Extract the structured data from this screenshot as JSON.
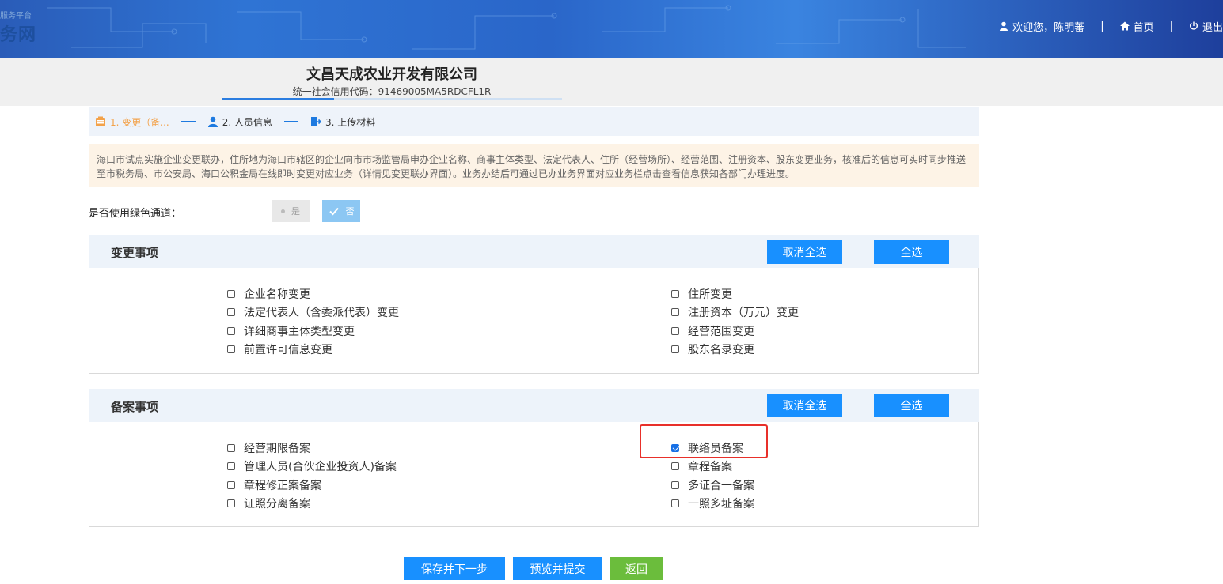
{
  "header": {
    "logo_small": "服务平台",
    "logo_text": "务网",
    "welcome": "欢迎您，陈明蕃",
    "home": "首页",
    "logout": "退出",
    "separator": "|"
  },
  "company": {
    "name": "文昌天成农业开发有限公司",
    "credit_code": "统一社会信用代码：91469005MA5RDCFL1R",
    "progress_fraction": 0.33
  },
  "steps": [
    {
      "label": "1. 变更（备...",
      "icon": "form-icon",
      "active": true
    },
    {
      "label": "2. 人员信息",
      "icon": "person-icon",
      "active": false
    },
    {
      "label": "3. 上传材料",
      "icon": "upload-icon",
      "active": false
    }
  ],
  "notice": "海口市试点实施企业变更联办，住所地为海口市辖区的企业向市市场监管局申办企业名称、商事主体类型、法定代表人、住所（经营场所）、经营范围、注册资本、股东变更业务，核准后的信息可实时同步推送至市税务局、市公安局、海口公积金局在线即时变更对应业务（详情见变更联办界面）。业务办结后可通过已办业务界面对应业务栏点击查看信息获知各部门办理进度。",
  "green_channel": {
    "label": "是否使用绿色通道：",
    "yes": "是",
    "no": "否",
    "selected": "否"
  },
  "change_section": {
    "title": "变更事项",
    "cancel_all": "取消全选",
    "select_all": "全选",
    "left": [
      {
        "label": "企业名称变更",
        "checked": false
      },
      {
        "label": "法定代表人（含委派代表）变更",
        "checked": false
      },
      {
        "label": "详细商事主体类型变更",
        "checked": false
      },
      {
        "label": "前置许可信息变更",
        "checked": false
      }
    ],
    "right": [
      {
        "label": "住所变更",
        "checked": false
      },
      {
        "label": "注册资本（万元）变更",
        "checked": false
      },
      {
        "label": "经营范围变更",
        "checked": false
      },
      {
        "label": "股东名录变更",
        "checked": false
      }
    ]
  },
  "filing_section": {
    "title": "备案事项",
    "cancel_all": "取消全选",
    "select_all": "全选",
    "left": [
      {
        "label": "经营期限备案",
        "checked": false
      },
      {
        "label": "管理人员(合伙企业投资人)备案",
        "checked": false
      },
      {
        "label": "章程修正案备案",
        "checked": false
      },
      {
        "label": "证照分离备案",
        "checked": false
      }
    ],
    "right": [
      {
        "label": "联络员备案",
        "checked": true
      },
      {
        "label": "章程备案",
        "checked": false
      },
      {
        "label": "多证合一备案",
        "checked": false
      },
      {
        "label": "一照多址备案",
        "checked": false
      }
    ]
  },
  "actions": {
    "save_next": "保存并下一步",
    "preview_submit": "预览并提交",
    "back": "返回"
  },
  "colors": {
    "primary": "#1890ff",
    "back_button": "#6bbd3c",
    "active_step": "#f3a24a",
    "highlight": "#e8302a"
  }
}
